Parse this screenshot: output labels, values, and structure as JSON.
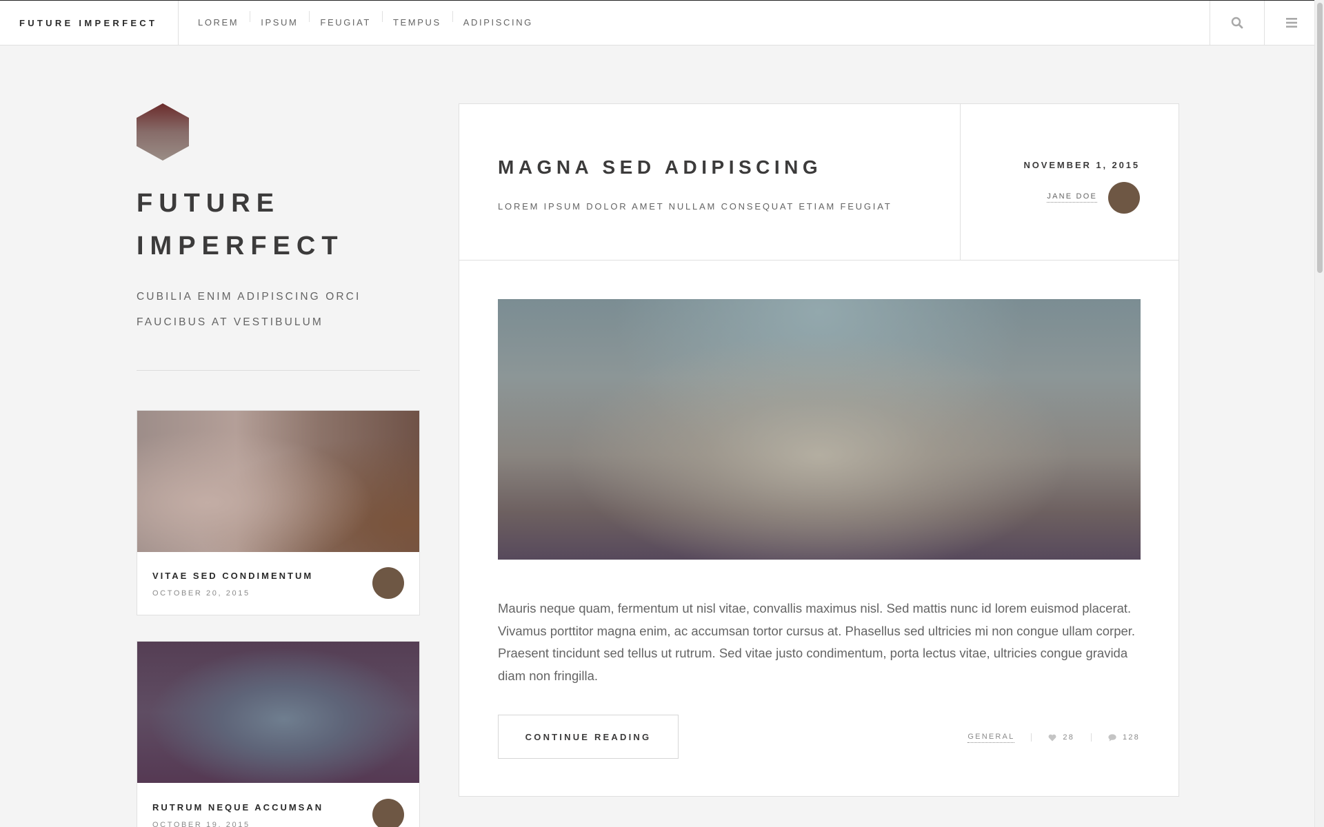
{
  "header": {
    "brand": "FUTURE IMPERFECT",
    "nav": [
      "LOREM",
      "IPSUM",
      "FEUGIAT",
      "TEMPUS",
      "ADIPISCING"
    ],
    "search_icon": "search-icon",
    "menu_icon": "menu-icon"
  },
  "intro": {
    "logo_icon": "hexagon-logo",
    "title_line1": "FUTURE",
    "title_line2": "IMPERFECT",
    "subtitle_line1": "CUBILIA ENIM ADIPISCING ORCI",
    "subtitle_line2": "FAUCIBUS AT VESTIBULUM"
  },
  "mini_posts": [
    {
      "title": "VITAE SED CONDIMENTUM",
      "date": "OCTOBER 20, 2015"
    },
    {
      "title": "RUTRUM NEQUE ACCUMSAN",
      "date": "OCTOBER 19, 2015"
    }
  ],
  "post": {
    "title": "MAGNA SED ADIPISCING",
    "subtitle": "LOREM IPSUM DOLOR AMET NULLAM CONSEQUAT ETIAM FEUGIAT",
    "date": "NOVEMBER 1, 2015",
    "author": "JANE DOE",
    "body": "Mauris neque quam, fermentum ut nisl vitae, convallis maximus nisl. Sed mattis nunc id lorem euismod placerat. Vivamus porttitor magna enim, ac accumsan tortor cursus at. Phasellus sed ultricies mi non congue ullam corper. Praesent tincidunt sed tellus ut rutrum. Sed vitae justo condimentum, porta lectus vitae, ultricies congue gravida diam non fringilla.",
    "button": "CONTINUE READING",
    "category": "GENERAL",
    "likes": "28",
    "comments": "128"
  },
  "colors": {
    "background": "#f4f4f4",
    "text_dark": "#3c3b3b",
    "text_muted": "#646464",
    "avatar": "#6e5744"
  }
}
